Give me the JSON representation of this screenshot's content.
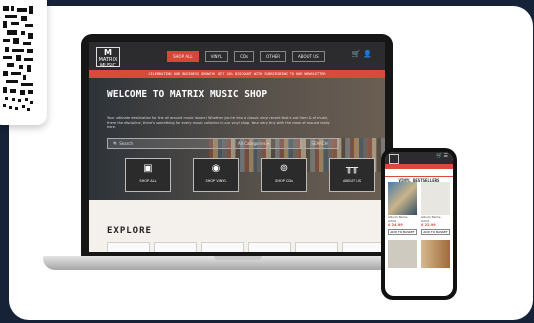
{
  "laptop": {
    "nav": {
      "logo_line1": "M",
      "logo_line2": "MATRIX MUSIC",
      "links": [
        "SHOP ALL",
        "VINYL",
        "CDs",
        "OTHER",
        "ABOUT US"
      ],
      "icons": [
        "cart-icon",
        "user-icon"
      ]
    },
    "promo": "CELEBRATING OUR BUSINESS GROWTH! GET 10% DISCOUNT WITH SUBSCRIBING TO OUR NEWSLETTER",
    "hero": {
      "title": "WELCOME TO MATRIX MUSIC SHOP",
      "description": "Your ultimate destination for the all around music lovers! Whether you're into a classic vinyl record that's out from & of music, there the discipline, there's something for every music collector in our vinyl shop. Your very tiny with the room of around really here.",
      "search_placeholder": "Search",
      "category": "All Categories",
      "search_button": "SEARCH"
    },
    "tiles": [
      {
        "label": "SHOP ALL",
        "icon": "record-sleeve-icon"
      },
      {
        "label": "SHOP VINYL",
        "icon": "vinyl-record-icon"
      },
      {
        "label": "SHOP CDs",
        "icon": "turntable-icon"
      },
      {
        "label": "ABOUT US",
        "icon": "matrix-logo-icon"
      }
    ],
    "explore_title": "EXPLORE"
  },
  "phone": {
    "section_title": "VINYL BESTSELLERS",
    "products": [
      {
        "title": "Album Name · Artist",
        "price": "£ 24.99",
        "button": "ADD TO BASKET"
      },
      {
        "title": "Album Name · Artist",
        "price": "£ 22.99",
        "button": "ADD TO BASKET"
      }
    ]
  },
  "colors": {
    "accent": "#d94a3d",
    "nav": "#2c2c2e",
    "frame": "#162238"
  }
}
